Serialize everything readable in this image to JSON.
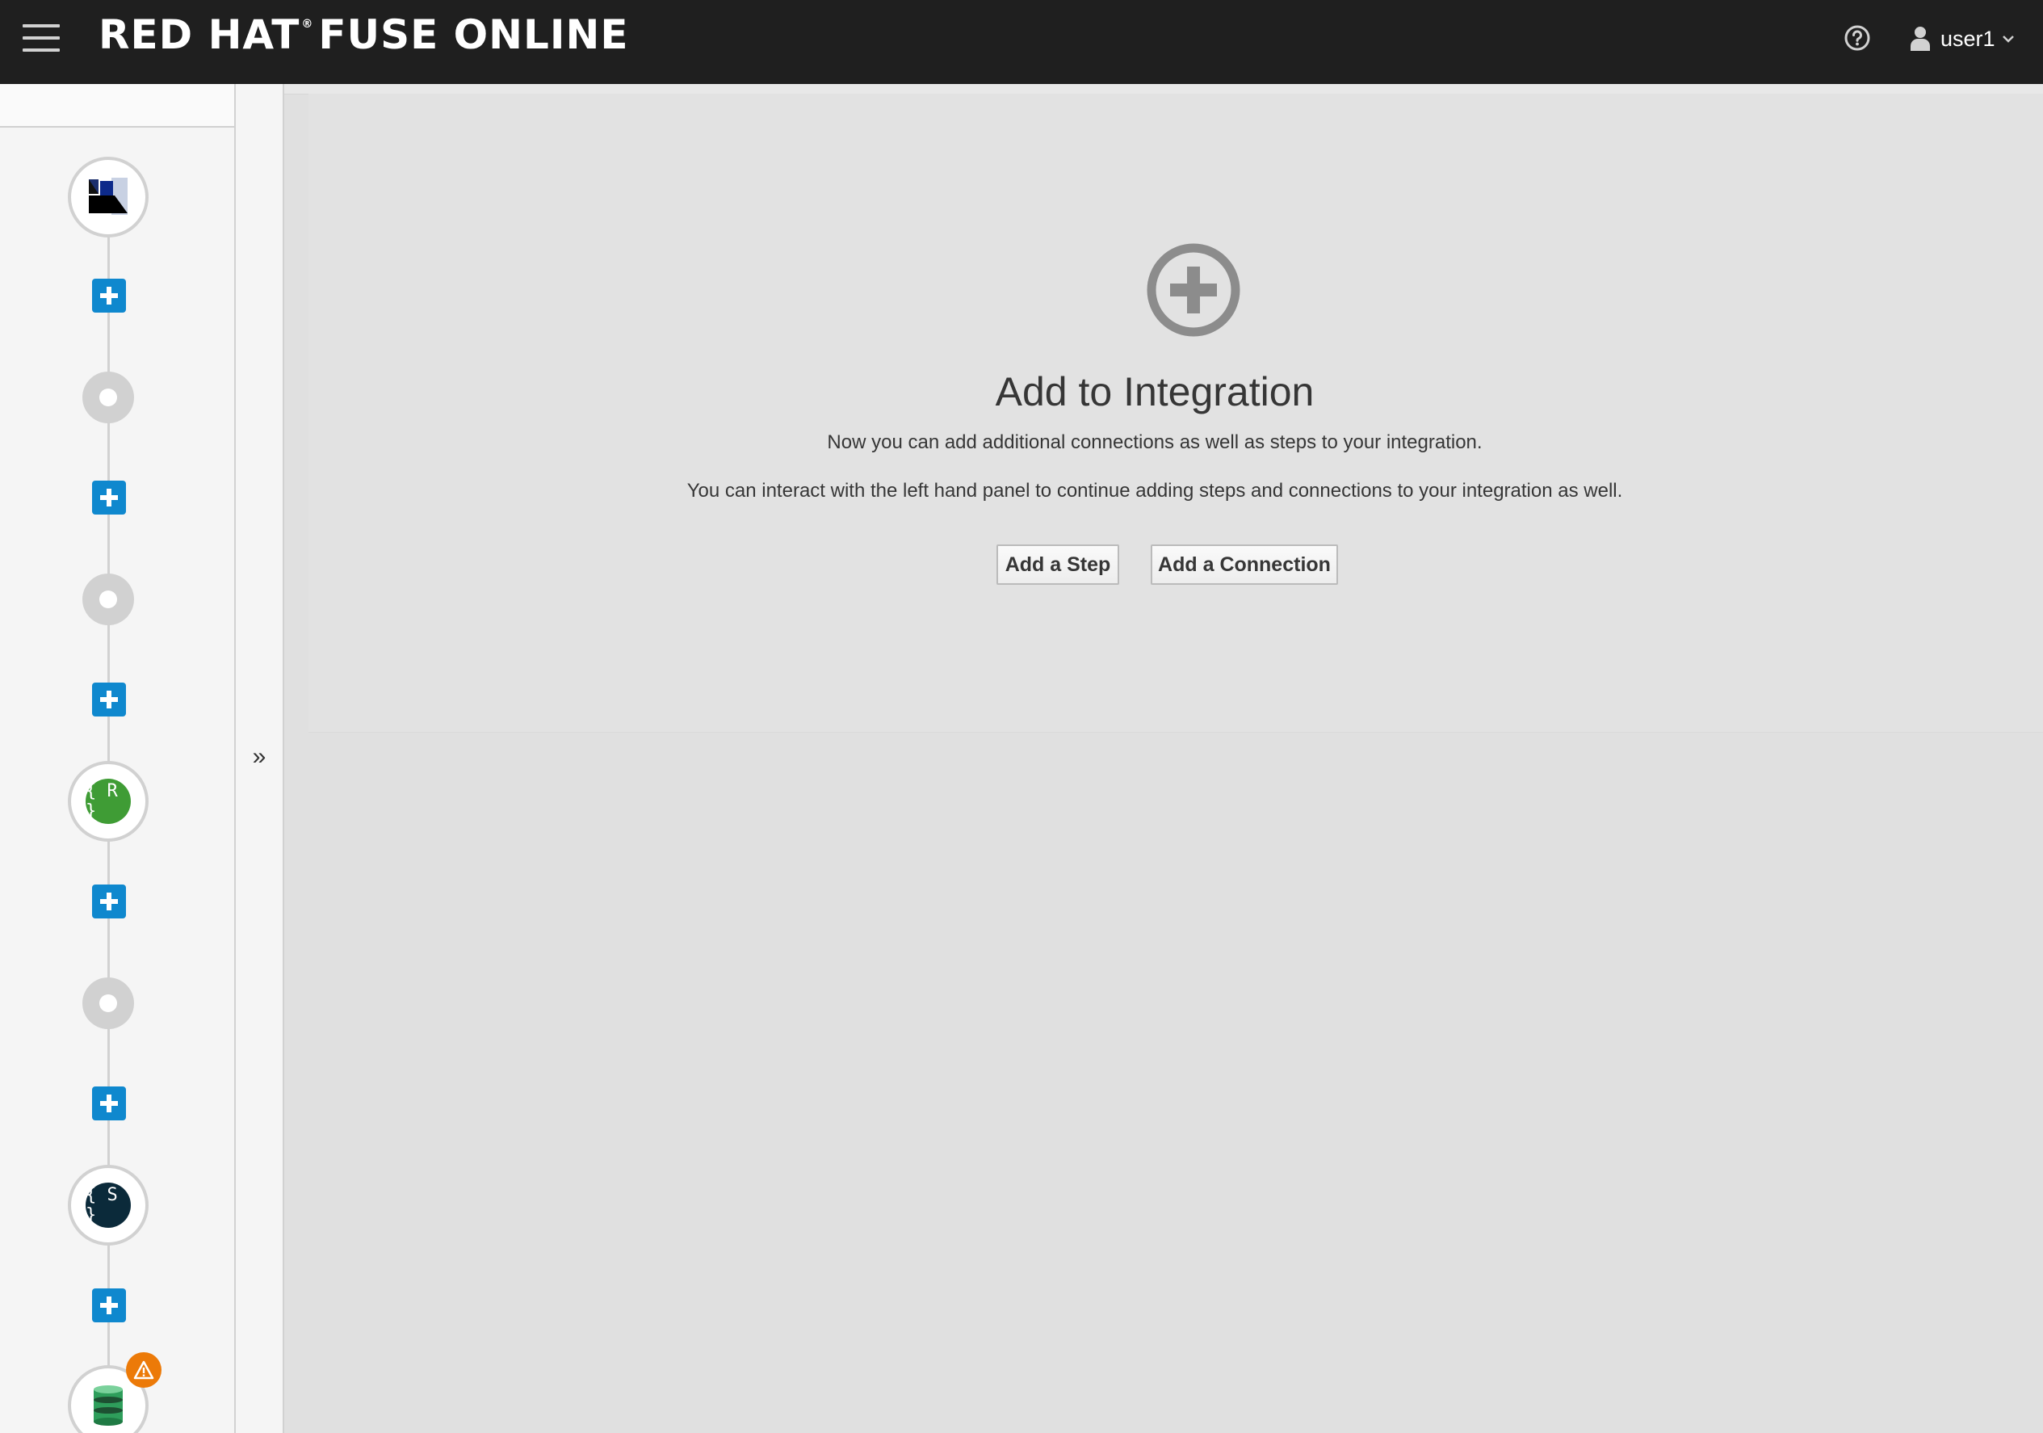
{
  "header": {
    "brand_left": "RED HAT",
    "brand_reg": "®",
    "brand_right": "FUSE ONLINE",
    "username": "user1",
    "help_icon": "question-circle-icon",
    "user_icon": "user-icon"
  },
  "flow": {
    "nodes": [
      {
        "type": "connection",
        "icon": "salesforce-logo-icon"
      },
      {
        "type": "step-placeholder"
      },
      {
        "type": "step-placeholder"
      },
      {
        "type": "step",
        "icon_text": "{ R }",
        "color": "#3f9c35"
      },
      {
        "type": "step-placeholder"
      },
      {
        "type": "step",
        "icon_text": "{ S }",
        "color": "#0b2a3a"
      },
      {
        "type": "connection",
        "icon": "database-icon",
        "warning": true
      }
    ]
  },
  "collapse_toggle": "»",
  "main": {
    "title": "Add to Integration",
    "line1": "Now you can add additional connections as well as steps to your integration.",
    "line2": "You can interact with the left hand panel to continue adding steps and connections to your integration as well.",
    "add_step_label": "Add a Step",
    "add_connection_label": "Add a Connection"
  },
  "colors": {
    "navbar": "#1f1f1f",
    "accent_blue": "#0f88ce",
    "warning_orange": "#ec7a08"
  }
}
